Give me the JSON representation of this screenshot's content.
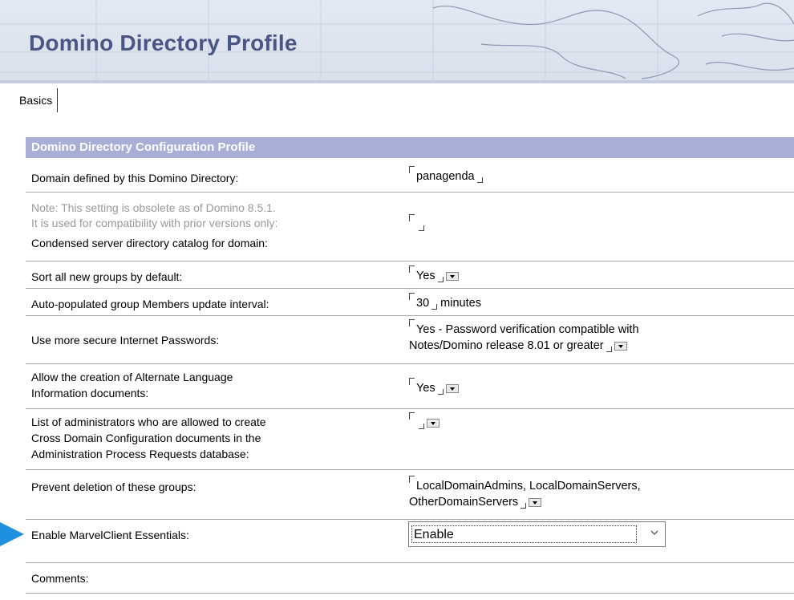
{
  "header": {
    "title": "Domino Directory Profile"
  },
  "tabs": [
    {
      "label": "Basics"
    }
  ],
  "section": {
    "title": "Domino Directory Configuration Profile"
  },
  "rows": {
    "domain": {
      "label": "Domain defined by this Domino Directory:",
      "value": "panagenda"
    },
    "catalog": {
      "note_line1": "Note: This setting is obsolete as of Domino 8.5.1.",
      "note_line2": "It is used for compatibility with prior versions only:",
      "label": "Condensed server directory catalog for domain:",
      "value": ""
    },
    "sort_groups": {
      "label": "Sort all new groups by default:",
      "value": "Yes"
    },
    "update_interval": {
      "label": "Auto-populated group Members update interval:",
      "value": "30",
      "unit": "minutes"
    },
    "secure_passwords": {
      "label": "Use more secure Internet Passwords:",
      "value_line1": "Yes - Password verification compatible with",
      "value_line2": "Notes/Domino release 8.01 or greater"
    },
    "alt_language": {
      "label_line1": "Allow the creation of Alternate Language",
      "label_line2": "Information documents:",
      "value": "Yes"
    },
    "cross_domain": {
      "label_line1": "List of administrators who are allowed to create",
      "label_line2": "Cross Domain Configuration documents in the",
      "label_line3": "Administration Process Requests database:",
      "value": ""
    },
    "prevent_deletion": {
      "label": "Prevent deletion of these groups:",
      "value_line1": "LocalDomainAdmins, LocalDomainServers,",
      "value_line2": "OtherDomainServers"
    },
    "marvelclient": {
      "label": "Enable MarvelClient Essentials:",
      "selected": "Enable"
    },
    "comments": {
      "label": "Comments:"
    }
  },
  "icons": {
    "dropdown": "dropdown-arrow-icon",
    "chevron": "chevron-down-icon",
    "pointer": "pointer-arrow-icon"
  },
  "colors": {
    "title": "#4a5686",
    "section_bg": "#a9aed6",
    "pointer": "#1f8fe0"
  }
}
